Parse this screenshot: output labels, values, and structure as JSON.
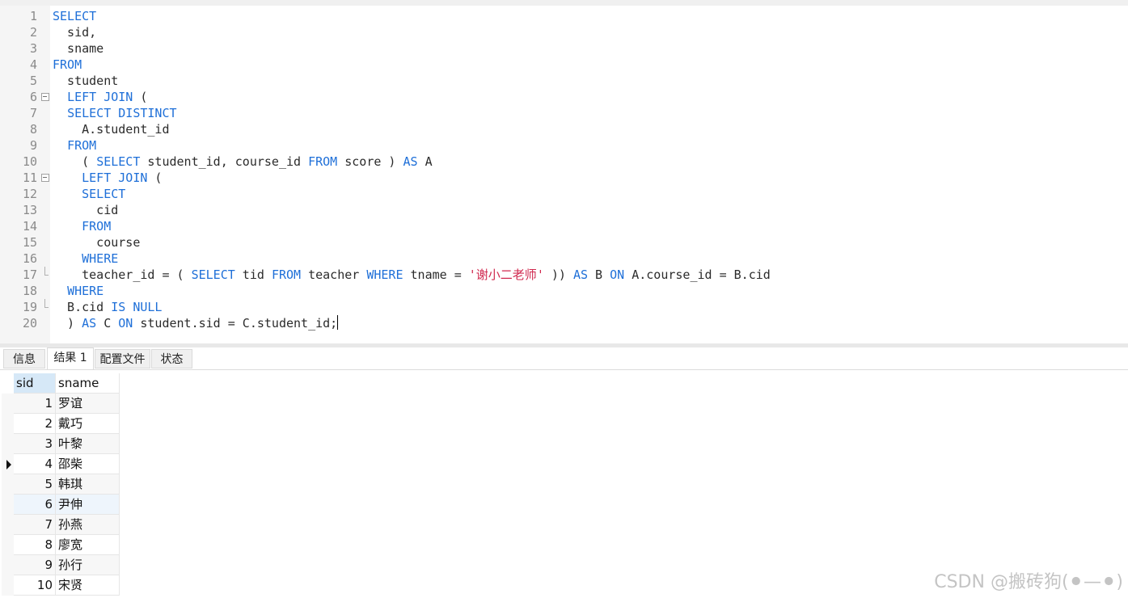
{
  "editor": {
    "lines": [
      {
        "n": "1",
        "fold": "",
        "tokens": [
          [
            "kw",
            "SELECT"
          ]
        ]
      },
      {
        "n": "2",
        "fold": "",
        "tokens": [
          [
            "t",
            "  sid,"
          ]
        ]
      },
      {
        "n": "3",
        "fold": "",
        "tokens": [
          [
            "t",
            "  sname"
          ]
        ]
      },
      {
        "n": "4",
        "fold": "",
        "tokens": [
          [
            "kw",
            "FROM"
          ]
        ]
      },
      {
        "n": "5",
        "fold": "",
        "tokens": [
          [
            "t",
            "  student"
          ]
        ]
      },
      {
        "n": "6",
        "fold": "box",
        "tokens": [
          [
            "t",
            "  "
          ],
          [
            "kw",
            "LEFT JOIN"
          ],
          [
            "t",
            " ("
          ]
        ]
      },
      {
        "n": "7",
        "fold": "",
        "tokens": [
          [
            "t",
            "  "
          ],
          [
            "kw",
            "SELECT DISTINCT"
          ]
        ]
      },
      {
        "n": "8",
        "fold": "",
        "tokens": [
          [
            "t",
            "    A.student_id"
          ]
        ]
      },
      {
        "n": "9",
        "fold": "",
        "tokens": [
          [
            "t",
            "  "
          ],
          [
            "kw",
            "FROM"
          ]
        ]
      },
      {
        "n": "10",
        "fold": "",
        "tokens": [
          [
            "t",
            "    ( "
          ],
          [
            "kw",
            "SELECT"
          ],
          [
            "t",
            " student_id, course_id "
          ],
          [
            "kw",
            "FROM"
          ],
          [
            "t",
            " score ) "
          ],
          [
            "kw",
            "AS"
          ],
          [
            "t",
            " A"
          ]
        ]
      },
      {
        "n": "11",
        "fold": "box",
        "tokens": [
          [
            "t",
            "    "
          ],
          [
            "kw",
            "LEFT JOIN"
          ],
          [
            "t",
            " ("
          ]
        ]
      },
      {
        "n": "12",
        "fold": "",
        "tokens": [
          [
            "t",
            "    "
          ],
          [
            "kw",
            "SELECT"
          ]
        ]
      },
      {
        "n": "13",
        "fold": "",
        "tokens": [
          [
            "t",
            "      cid"
          ]
        ]
      },
      {
        "n": "14",
        "fold": "",
        "tokens": [
          [
            "t",
            "    "
          ],
          [
            "kw",
            "FROM"
          ]
        ]
      },
      {
        "n": "15",
        "fold": "",
        "tokens": [
          [
            "t",
            "      course"
          ]
        ]
      },
      {
        "n": "16",
        "fold": "",
        "tokens": [
          [
            "t",
            "    "
          ],
          [
            "kw",
            "WHERE"
          ]
        ]
      },
      {
        "n": "17",
        "fold": "end",
        "tokens": [
          [
            "t",
            "    teacher_id = ( "
          ],
          [
            "kw",
            "SELECT"
          ],
          [
            "t",
            " tid "
          ],
          [
            "kw",
            "FROM"
          ],
          [
            "t",
            " teacher "
          ],
          [
            "kw",
            "WHERE"
          ],
          [
            "t",
            " tname = "
          ],
          [
            "str",
            "'谢小二老师'"
          ],
          [
            "t",
            " )) "
          ],
          [
            "kw",
            "AS"
          ],
          [
            "t",
            " B "
          ],
          [
            "kw",
            "ON"
          ],
          [
            "t",
            " A.course_id = B.cid"
          ]
        ]
      },
      {
        "n": "18",
        "fold": "",
        "tokens": [
          [
            "t",
            "  "
          ],
          [
            "kw",
            "WHERE"
          ]
        ]
      },
      {
        "n": "19",
        "fold": "end",
        "tokens": [
          [
            "t",
            "  B.cid "
          ],
          [
            "kw",
            "IS NULL"
          ]
        ]
      },
      {
        "n": "20",
        "fold": "",
        "tokens": [
          [
            "t",
            "  ) "
          ],
          [
            "kw",
            "AS"
          ],
          [
            "t",
            " C "
          ],
          [
            "kw",
            "ON"
          ],
          [
            "t",
            " student.sid = C.student_id;"
          ]
        ],
        "caret": true
      }
    ]
  },
  "tabs": [
    {
      "label": "信息",
      "active": false
    },
    {
      "label": "结果 1",
      "active": true
    },
    {
      "label": "配置文件",
      "active": false
    },
    {
      "label": "状态",
      "active": false
    }
  ],
  "result": {
    "columns": [
      "sid",
      "sname"
    ],
    "current_row": 3,
    "rows": [
      [
        "1",
        "罗谊"
      ],
      [
        "2",
        "戴巧"
      ],
      [
        "3",
        "叶黎"
      ],
      [
        "4",
        "邵柴"
      ],
      [
        "5",
        "韩琪"
      ],
      [
        "6",
        "尹伸"
      ],
      [
        "7",
        "孙燕"
      ],
      [
        "8",
        "廖宽"
      ],
      [
        "9",
        "孙行"
      ],
      [
        "10",
        "宋贤"
      ]
    ]
  },
  "watermark": "CSDN @搬砖狗(⚫—⚫)",
  "colors": {
    "keyword": "#1e6fd8",
    "string": "#d0284e",
    "text": "#2b2b2b",
    "line_number": "#8a8a8a"
  }
}
